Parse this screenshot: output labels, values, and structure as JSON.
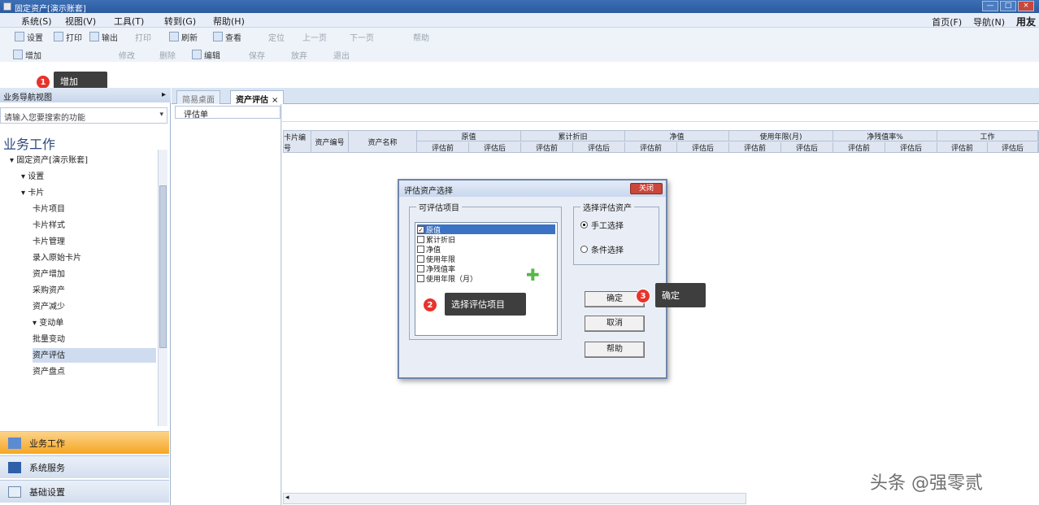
{
  "window": {
    "title": "固定资产[演示账套]",
    "min": "—",
    "max": "□",
    "close": "×"
  },
  "menu": {
    "items": [
      "系统(S)",
      "视图(V)",
      "工具(T)",
      "转到(G)",
      "帮助(H)"
    ],
    "right": {
      "home": "首页(F)",
      "nav": "导航(N)",
      "brand": "用友"
    }
  },
  "toolbar1": {
    "buttons": [
      {
        "label": "设置",
        "disabled": false
      },
      {
        "label": "打印",
        "disabled": false
      },
      {
        "label": "输出",
        "disabled": false
      },
      {
        "label": "打印",
        "disabled": true
      },
      {
        "label": "刷新",
        "disabled": false
      },
      {
        "label": "查看",
        "disabled": false
      },
      {
        "label": "定位",
        "disabled": true
      },
      {
        "label": "上一页",
        "disabled": true
      },
      {
        "label": "下一页",
        "disabled": true
      },
      {
        "label": "帮助",
        "disabled": true
      }
    ]
  },
  "toolbar2": {
    "buttons": [
      {
        "label": "增加",
        "disabled": false
      },
      {
        "label": "修改",
        "disabled": true
      },
      {
        "label": "删除",
        "disabled": true
      },
      {
        "label": "编辑",
        "disabled": false
      },
      {
        "label": "保存",
        "disabled": true
      },
      {
        "label": "放弃",
        "disabled": true
      },
      {
        "label": "退出",
        "disabled": true
      }
    ]
  },
  "callouts": {
    "c1": {
      "num": "1",
      "text": "增加"
    },
    "c2": {
      "num": "2",
      "text": "选择评估项目"
    },
    "c3": {
      "num": "3",
      "text": "确定"
    }
  },
  "left_panel": {
    "header": "业务导航视图",
    "pin": "▸",
    "search_placeholder": "请输入您要搜索的功能",
    "section_title": "业务工作",
    "tree": [
      {
        "label": "▾ 固定资产[演示账套]",
        "indent": 0
      },
      {
        "label": "▾ 设置",
        "indent": 1
      },
      {
        "label": "▾ 卡片",
        "indent": 1
      },
      {
        "label": "卡片项目",
        "indent": 2
      },
      {
        "label": "卡片样式",
        "indent": 2
      },
      {
        "label": "卡片管理",
        "indent": 2
      },
      {
        "label": "录入原始卡片",
        "indent": 2
      },
      {
        "label": "资产增加",
        "indent": 2
      },
      {
        "label": "采购资产",
        "indent": 2
      },
      {
        "label": "资产减少",
        "indent": 2
      },
      {
        "label": "▾ 变动单",
        "indent": 2
      },
      {
        "label": "批量变动",
        "indent": 2
      },
      {
        "label": "资产评估",
        "indent": 2,
        "selected": true
      },
      {
        "label": "资产盘点",
        "indent": 2
      }
    ],
    "bottom_nav": [
      {
        "label": "业务工作",
        "active": true
      },
      {
        "label": "系统服务",
        "active": false
      },
      {
        "label": "基础设置",
        "active": false
      }
    ]
  },
  "tabs": [
    {
      "label": "简易桌面",
      "active": false
    },
    {
      "label": "资产评估",
      "active": true,
      "close": "×"
    }
  ],
  "main": {
    "sub_tab": "评估单",
    "grid": {
      "single_cols": [
        "卡片编号",
        "资产编号",
        "资产名称"
      ],
      "groups": [
        "原值",
        "累计折旧",
        "净值",
        "使用年限(月)",
        "净残值率%",
        "工作"
      ],
      "subheaders": [
        "评估前",
        "评估后"
      ]
    }
  },
  "dialog": {
    "title": "评估资产选择",
    "close_label": "关闭",
    "group1_label": "可评估项目",
    "items": [
      {
        "label": "原值",
        "checked": true,
        "selected": true
      },
      {
        "label": "累计折旧",
        "checked": false
      },
      {
        "label": "净值",
        "checked": false
      },
      {
        "label": "使用年限",
        "checked": false
      },
      {
        "label": "净残值率",
        "checked": false
      },
      {
        "label": "使用年限（月）",
        "checked": false
      }
    ],
    "group2_label": "选择评估资产",
    "radio_manual": "手工选择",
    "radio_cond": "条件选择",
    "ok": "确定",
    "cancel": "取消",
    "help": "帮助"
  },
  "watermark": "头条 @强零贰"
}
